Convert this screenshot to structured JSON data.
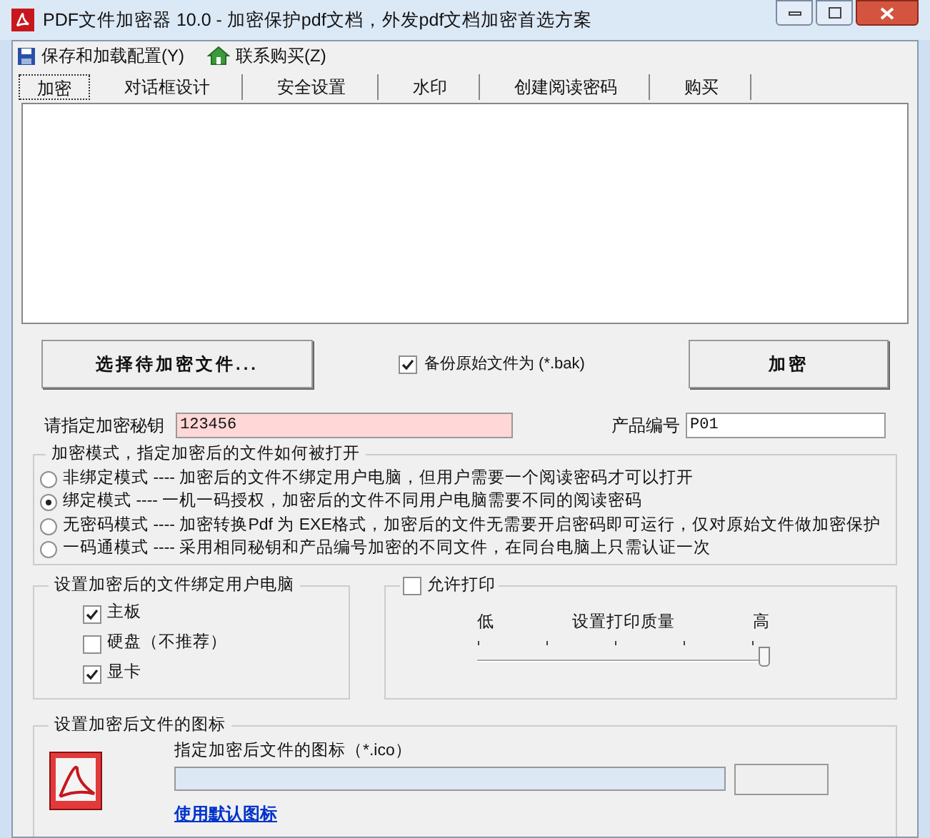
{
  "window": {
    "title": "PDF文件加密器 10.0 - 加密保护pdf文档，外发pdf文档加密首选方案"
  },
  "menu": [
    {
      "label": "保存和加载配置(Y)",
      "kind": "save"
    },
    {
      "label": "联系购买(Z)",
      "kind": "home"
    }
  ],
  "tabs": [
    {
      "label": "加密",
      "selected": true
    },
    {
      "label": "对话框设计",
      "selected": false
    },
    {
      "label": "安全设置",
      "selected": false
    },
    {
      "label": "水印",
      "selected": false
    },
    {
      "label": "创建阅读密码",
      "selected": false
    },
    {
      "label": "购买",
      "selected": false
    }
  ],
  "select_button": "选择待加密文件...",
  "backup": {
    "label": "备份原始文件为 (*.bak)",
    "checked": true
  },
  "encrypt_button": "加密",
  "key": {
    "label": "请指定加密秘钥",
    "value": "123456"
  },
  "product": {
    "label": "产品编号",
    "value": "P01"
  },
  "mode": {
    "title": "加密模式，指定加密后的文件如何被打开",
    "options": [
      {
        "label": "非绑定模式 ---- 加密后的文件不绑定用户电脑，但用户需要一个阅读密码才可以打开",
        "selected": false
      },
      {
        "label": "绑定模式 ---- 一机一码授权，加密后的文件不同用户电脑需要不同的阅读密码",
        "selected": true
      },
      {
        "label": "无密码模式 ---- 加密转换Pdf 为 EXE格式，加密后的文件无需要开启密码即可运行，仅对原始文件做加密保护",
        "selected": false
      },
      {
        "label": "一码通模式 ---- 采用相同秘钥和产品编号加密的不同文件，在同台电脑上只需认证一次",
        "selected": false
      }
    ]
  },
  "bind": {
    "title": "设置加密后的文件绑定用户电脑",
    "items": [
      {
        "label": "主板",
        "checked": true
      },
      {
        "label": "硬盘（不推荐）",
        "checked": false
      },
      {
        "label": "显卡",
        "checked": true
      }
    ]
  },
  "print": {
    "label": "允许打印",
    "checked": false,
    "low": "低",
    "caption": "设置打印质量",
    "high": "高",
    "level": 1
  },
  "icon_group": {
    "title": "设置加密后文件的图标",
    "field_label": "指定加密后文件的图标（*.ico）",
    "link": "使用默认图标"
  }
}
